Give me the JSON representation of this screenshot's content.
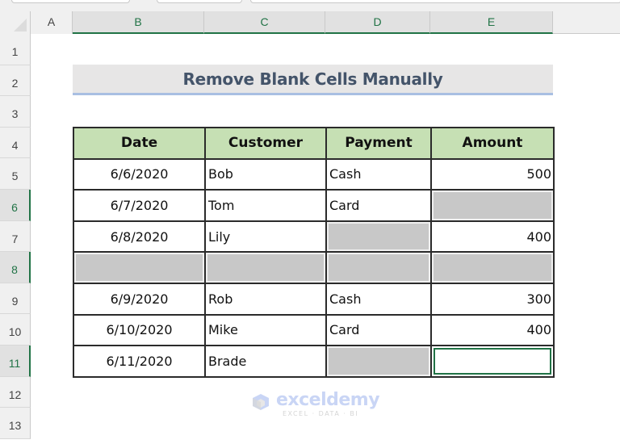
{
  "sheet": {
    "columns": [
      "A",
      "B",
      "C",
      "D",
      "E"
    ],
    "selected_columns": [
      "B",
      "C",
      "D",
      "E"
    ],
    "rows": [
      "1",
      "2",
      "3",
      "4",
      "5",
      "6",
      "7",
      "8",
      "9",
      "10",
      "11",
      "12",
      "13"
    ],
    "selected_rows": [
      "6",
      "8",
      "11"
    ],
    "active_cell": "E11"
  },
  "title": "Remove Blank Cells Manually",
  "table": {
    "headers": [
      "Date",
      "Customer",
      "Payment",
      "Amount"
    ],
    "rows": [
      {
        "date": "6/6/2020",
        "customer": "Bob",
        "payment": "Cash",
        "amount": "500"
      },
      {
        "date": "6/7/2020",
        "customer": "Tom",
        "payment": "Card",
        "amount": null
      },
      {
        "date": "6/8/2020",
        "customer": "Lily",
        "payment": null,
        "amount": "400"
      },
      {
        "date": null,
        "customer": null,
        "payment": null,
        "amount": null
      },
      {
        "date": "6/9/2020",
        "customer": "Rob",
        "payment": "Cash",
        "amount": "300"
      },
      {
        "date": "6/10/2020",
        "customer": "Mike",
        "payment": "Card",
        "amount": "400"
      },
      {
        "date": "6/11/2020",
        "customer": "Brade",
        "payment": null,
        "amount": null
      }
    ]
  },
  "watermark": {
    "brand": "exceldemy",
    "tagline": "EXCEL · DATA · BI"
  },
  "colors": {
    "header_fill": "#c6e0b4",
    "title_fill": "#e7e6e6",
    "title_text": "#44546a",
    "title_underline": "#a9bfe2",
    "blank_fill": "#c8c8c8",
    "selection_green": "#217346"
  }
}
